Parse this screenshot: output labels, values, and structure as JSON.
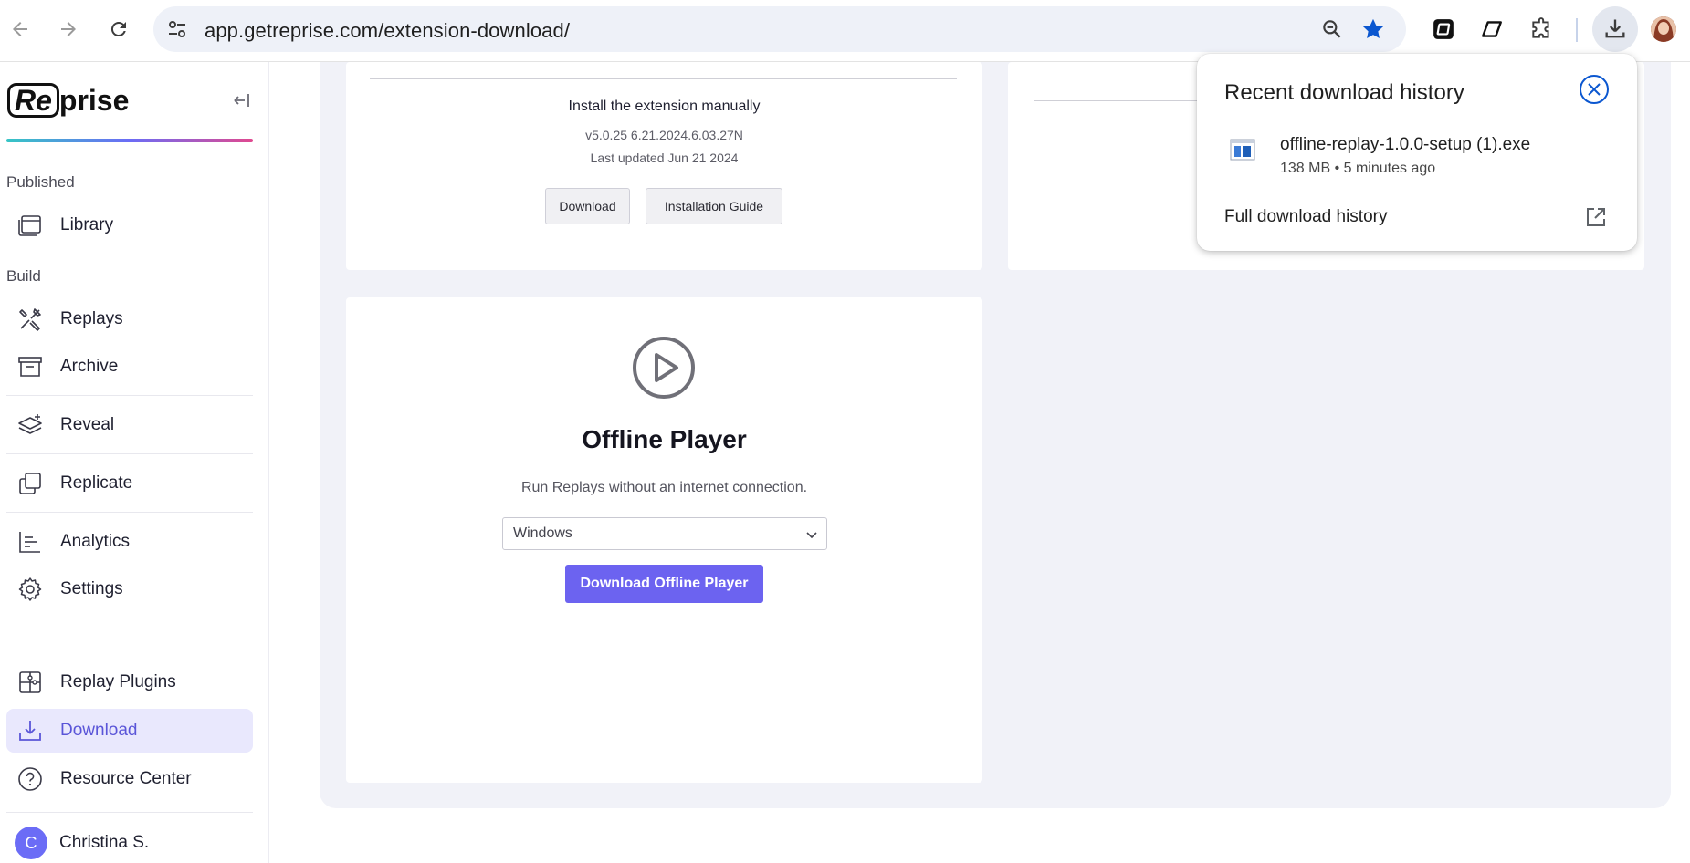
{
  "browser": {
    "url": "app.getreprise.com/extension-download/"
  },
  "sidebar": {
    "logo_boxed": "Re",
    "logo_rest": "prise",
    "sections": {
      "published": "Published",
      "build": "Build"
    },
    "items": [
      {
        "label": "Library",
        "icon": "library-icon"
      },
      {
        "label": "Replays",
        "icon": "tools-icon"
      },
      {
        "label": "Archive",
        "icon": "archive-icon"
      },
      {
        "label": "Reveal",
        "icon": "layers-icon"
      },
      {
        "label": "Replicate",
        "icon": "copy-icon"
      },
      {
        "label": "Analytics",
        "icon": "chart-icon"
      },
      {
        "label": "Settings",
        "icon": "gear-icon"
      },
      {
        "label": "Replay Plugins",
        "icon": "puzzle-icon"
      },
      {
        "label": "Download",
        "icon": "download-icon",
        "active": true
      },
      {
        "label": "Resource Center",
        "icon": "help-icon"
      }
    ],
    "user": {
      "initial": "C",
      "name": "Christina S."
    }
  },
  "extension_card": {
    "title": "Install the extension manually",
    "version": "v5.0.25 6.21.2024.6.03.27N",
    "updated": "Last updated Jun 21 2024",
    "download_label": "Download",
    "guide_label": "Installation Guide"
  },
  "offline_player": {
    "title": "Offline Player",
    "description": "Run Replays without an internet connection.",
    "os_selected": "Windows",
    "button_label": "Download Offline Player"
  },
  "download_popup": {
    "title": "Recent download history",
    "file_name": "offline-replay-1.0.0-setup (1).exe",
    "file_meta": "138 MB • 5 minutes ago",
    "full_history": "Full download history"
  },
  "colors": {
    "accent": "#6c63f0",
    "active_bg": "#e9e8fd",
    "main_bg": "#f1f2f8",
    "chrome_blue": "#0b57d0"
  }
}
